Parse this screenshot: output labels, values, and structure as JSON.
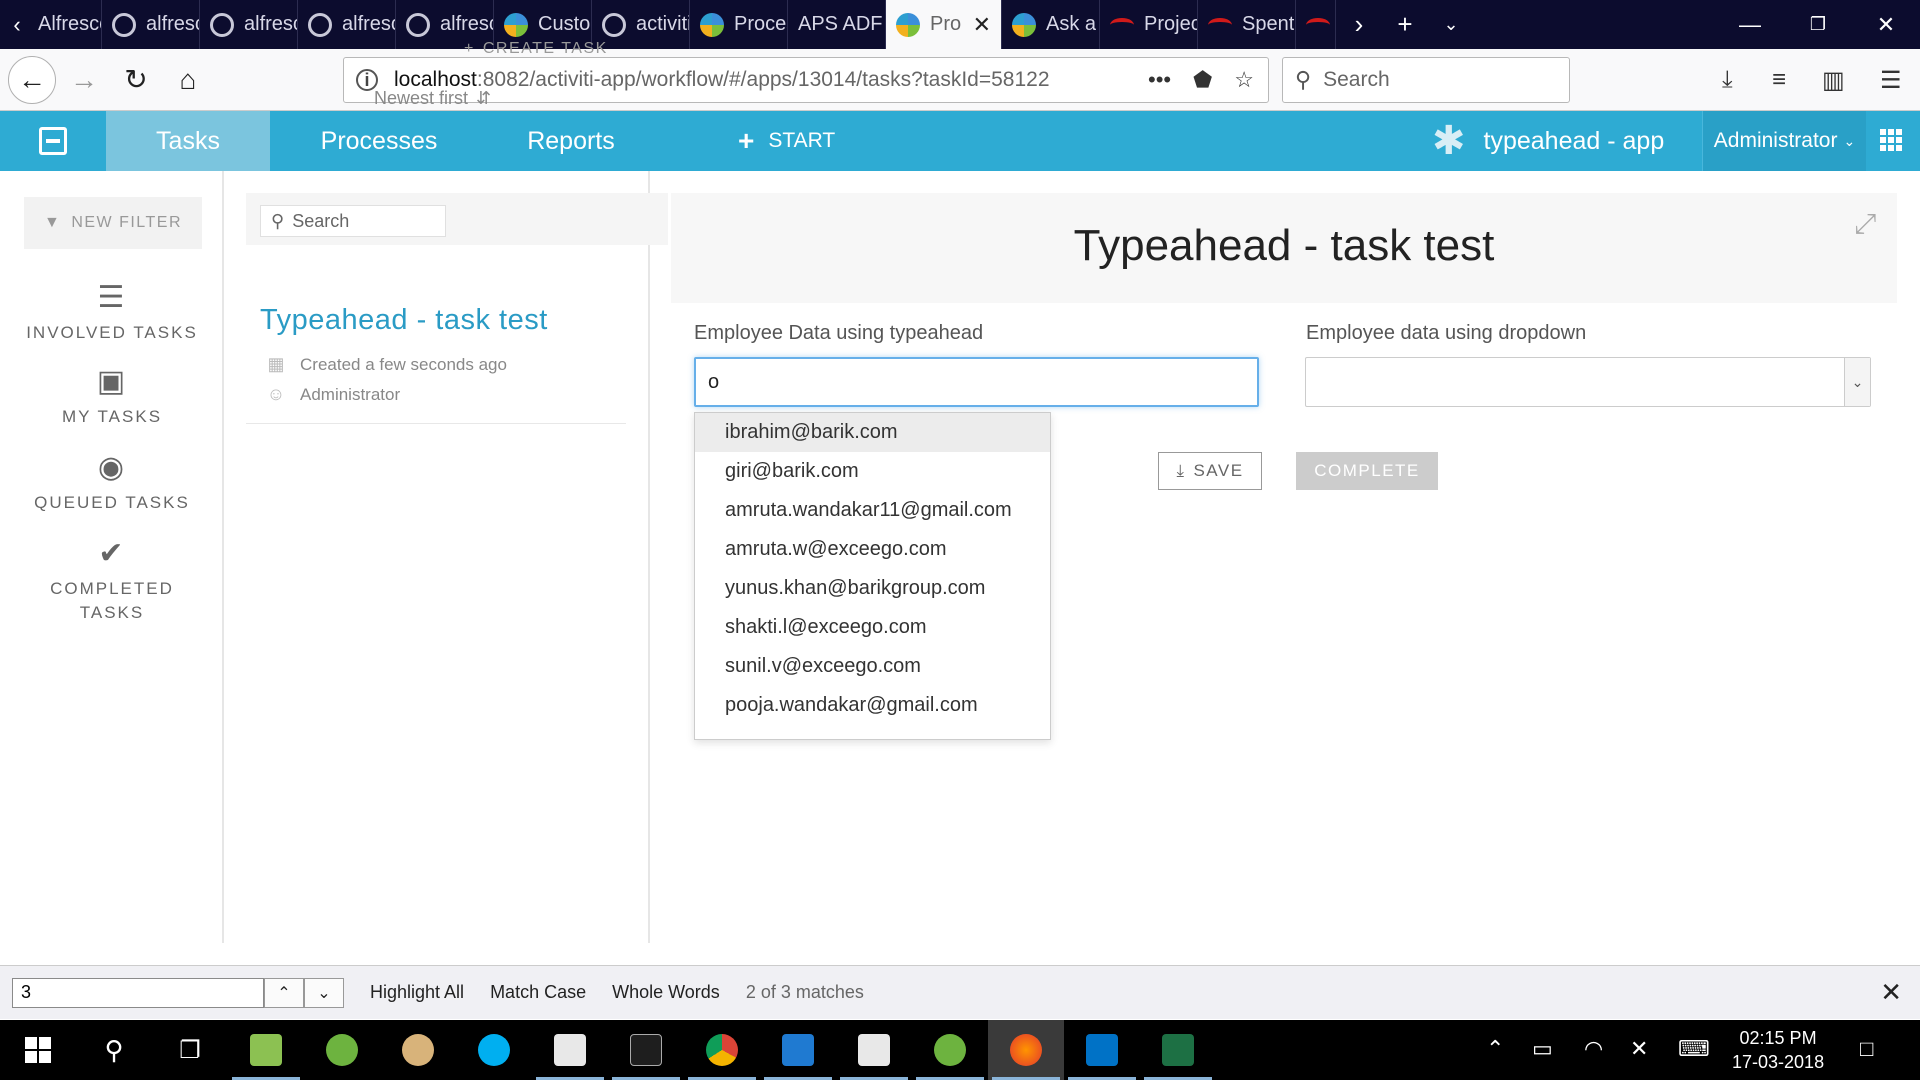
{
  "browser": {
    "tabs": [
      {
        "title": "Alfresco",
        "icon": "fav-wheel"
      },
      {
        "title": "alfresco",
        "icon": "github-icon"
      },
      {
        "title": "alfresco",
        "icon": "github-icon"
      },
      {
        "title": "alfresco",
        "icon": "github-icon"
      },
      {
        "title": "alfresco",
        "icon": "github-icon"
      },
      {
        "title": "Customi",
        "icon": "activiti-icon"
      },
      {
        "title": "activiti",
        "icon": "github-icon"
      },
      {
        "title": "Process",
        "icon": "activiti-icon"
      },
      {
        "title": "APS ADF A",
        "icon": ""
      },
      {
        "title": "Pro",
        "icon": "activiti-icon",
        "active": true
      },
      {
        "title": "Ask a Q",
        "icon": "activiti-icon"
      },
      {
        "title": "Project",
        "icon": "redhat-icon"
      },
      {
        "title": "Spent",
        "icon": "redhat-icon"
      }
    ],
    "url_host": "localhost",
    "url_path": ":8082/activiti-app/workflow/#/apps/13014/tasks?taskId=58122",
    "search_placeholder": "Search"
  },
  "app": {
    "nav": {
      "tasks": "Tasks",
      "processes": "Processes",
      "reports": "Reports",
      "start": "START"
    },
    "app_name": "typeahead - app",
    "user_menu": "Administrator",
    "accent_color": "#2eabd3"
  },
  "filters": {
    "new_filter": "NEW FILTER",
    "items": [
      {
        "label": "INVOLVED TASKS",
        "icon": "list-icon"
      },
      {
        "label": "MY TASKS",
        "icon": "inbox-icon"
      },
      {
        "label": "QUEUED TASKS",
        "icon": "record-icon"
      },
      {
        "label": "COMPLETED",
        "label2": "TASKS",
        "icon": "check-circle-icon"
      }
    ]
  },
  "tasklist": {
    "search_placeholder": "Search",
    "create_task": "CREATE TASK",
    "sort_label": "Newest first",
    "task": {
      "title": "Typeahead - task test",
      "created": "Created a few seconds ago",
      "assignee": "Administrator"
    }
  },
  "form": {
    "title": "Typeahead - task test",
    "typeahead_label": "Employee Data using typeahead",
    "typeahead_value": "o",
    "dropdown_label": "Employee data using dropdown",
    "dropdown_value": "",
    "suggestions": [
      "ibrahim@barik.com",
      "giri@barik.com",
      "amruta.wandakar11@gmail.com",
      "amruta.w@exceego.com",
      "yunus.khan@barikgroup.com",
      "shakti.l@exceego.com",
      "sunil.v@exceego.com",
      "pooja.wandakar@gmail.com"
    ],
    "save_label": "SAVE",
    "complete_label": "COMPLETE"
  },
  "findbar": {
    "query": "3",
    "highlight_all": "Highlight All",
    "match_case": "Match Case",
    "whole_words": "Whole Words",
    "match_count": "2 of 3 matches"
  },
  "taskbar": {
    "time": "02:15 PM",
    "date": "17-03-2018"
  }
}
